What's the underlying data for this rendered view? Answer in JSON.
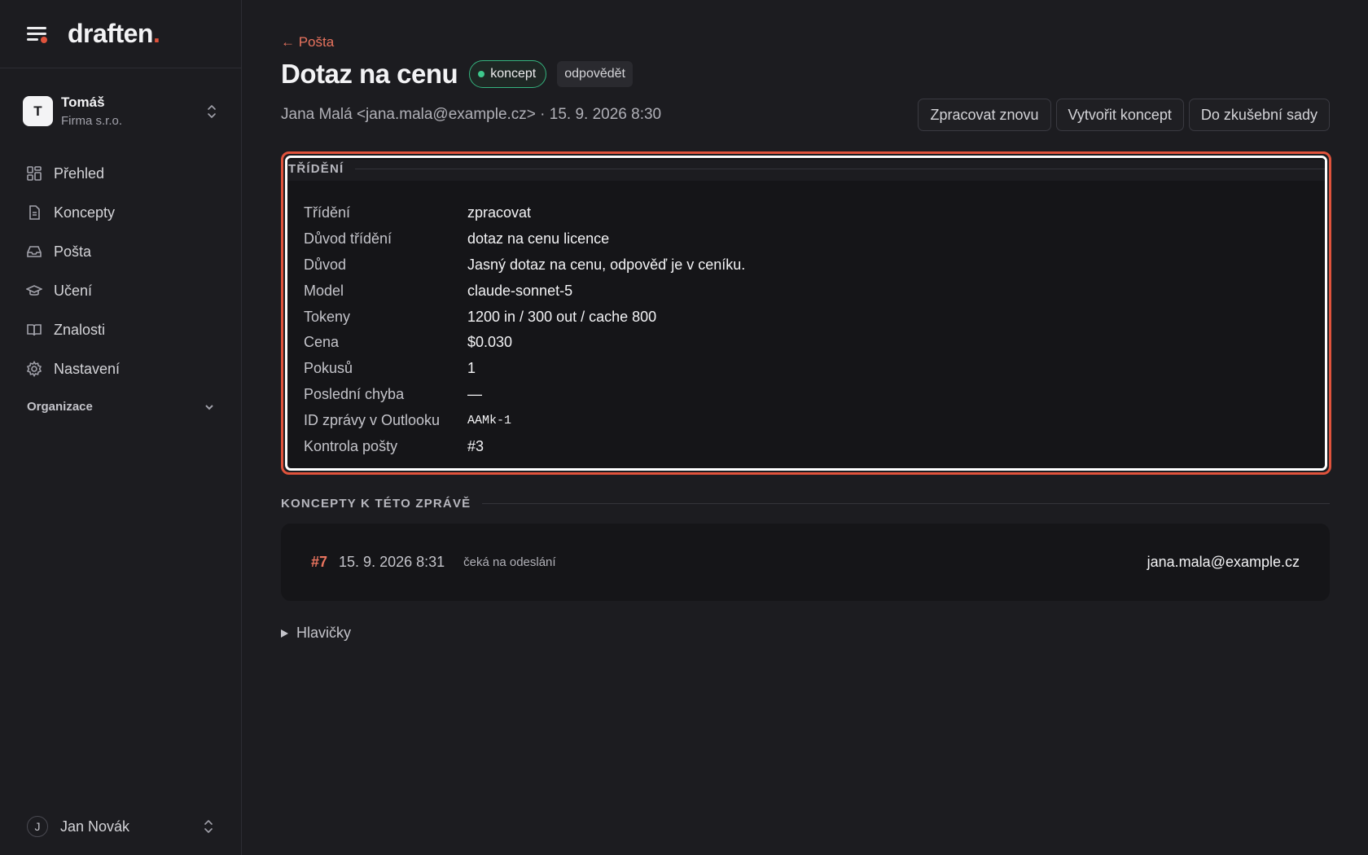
{
  "brand": {
    "name": "draften",
    "accent": "."
  },
  "workspace": {
    "initial": "T",
    "name": "Tomáš",
    "org": "Firma s.r.o."
  },
  "nav": [
    {
      "label": "Přehled",
      "icon": "dashboard-icon"
    },
    {
      "label": "Koncepty",
      "icon": "document-icon"
    },
    {
      "label": "Pošta",
      "icon": "inbox-icon"
    },
    {
      "label": "Učení",
      "icon": "graduation-cap-icon"
    },
    {
      "label": "Znalosti",
      "icon": "book-icon"
    },
    {
      "label": "Nastavení",
      "icon": "gear-icon"
    }
  ],
  "org_section": {
    "label": "Organizace"
  },
  "user": {
    "initial": "J",
    "name": "Jan Novák"
  },
  "header": {
    "back_label": "← Pošta",
    "title": "Dotaz na cenu",
    "status_badge": "koncept",
    "intent_badge": "odpovědět",
    "meta": "Jana Malá <jana.mala@example.cz> · 15. 9. 2026 8:30"
  },
  "actions": {
    "reprocess": "Zpracovat znovu",
    "create_draft": "Vytvořit koncept",
    "to_test_set": "Do zkušební sady"
  },
  "triage": {
    "title": "TŘÍDĚNÍ",
    "rows": [
      {
        "key": "Třídění",
        "value": "zpracovat"
      },
      {
        "key": "Důvod třídění",
        "value": "dotaz na cenu licence"
      },
      {
        "key": "Důvod",
        "value": "Jasný dotaz na cenu, odpověď je v ceníku."
      },
      {
        "key": "Model",
        "value": "claude-sonnet-5"
      },
      {
        "key": "Tokeny",
        "value": "1200 in / 300 out / cache 800"
      },
      {
        "key": "Cena",
        "value": "$0.030"
      },
      {
        "key": "Pokusů",
        "value": "1"
      },
      {
        "key": "Poslední chyba",
        "value": "—"
      },
      {
        "key": "ID zprávy v Outlooku",
        "value": "AAMk-1"
      },
      {
        "key": "Kontrola pošty",
        "value": "#3"
      }
    ]
  },
  "drafts": {
    "title": "KONCEPTY K TÉTO ZPRÁVĚ",
    "items": [
      {
        "number": "#7",
        "date": "15. 9. 2026 8:31",
        "status": "čeká na odeslání",
        "recipient": "jana.mala@example.cz"
      }
    ]
  },
  "headers_toggle": {
    "label": "Hlavičky"
  },
  "colors": {
    "accent": "#e0533c",
    "status_green": "#3ec98d",
    "background": "#1c1c20",
    "panel": "#151518"
  }
}
